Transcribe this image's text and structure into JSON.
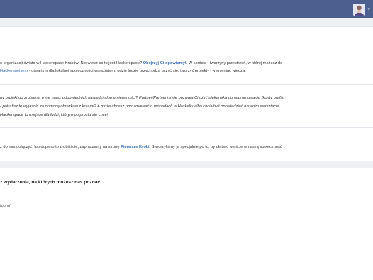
{
  "topbar": {
    "user_caret": "▾"
  },
  "intro": {
    "p1_l1_a": "o organizacji świata w Hackerspace Kraków. Nie wiesz co to jest Hackerspace? ",
    "p1_l1_link": "Obejrzyj Ci opowiemy!",
    "p1_l1_b": ". W skrócie - twarzyny przestrzeń, w której możesz do",
    "p1_l2_link": "Hackerspejsem",
    "p1_l2_b": " - otwartym dla lokalnej społeczności warsztatem, gdzie ludzie przychodzą uczyć się, tworzyć projekty i wymieniać wiedzą."
  },
  "projects": {
    "l1": "ny projekt do zrobienia u nie masz odpowiednich narzędzi albo umiejętności? Partner/Partnerka nie pozwala Ci użyć piekarnika do napromowania (konty grafiki",
    "l2": "- potrafisz to wyjaśnić za pomocą obrazków z kotami? A może chcesz porozmawiać o monadach w Haskellu albo chciałbyś opowiedzieć o swoim warsztacie",
    "l3": "Hackerspace to miejsce dla ludzi, którym po prostu się chce!"
  },
  "join": {
    "text_a": "z do nas dołączyć, lub dopiero to zrobiliście, zapraszamy na stronę ",
    "link": "Pierwsze Kroki",
    "text_b": ". Stworzyliśmy ją specjalnie po to, by ułatwić wejście w naszą społeczność"
  },
  "events": {
    "title": "z wydarzenia, na których możesz nas poznać",
    "empty": "found"
  }
}
